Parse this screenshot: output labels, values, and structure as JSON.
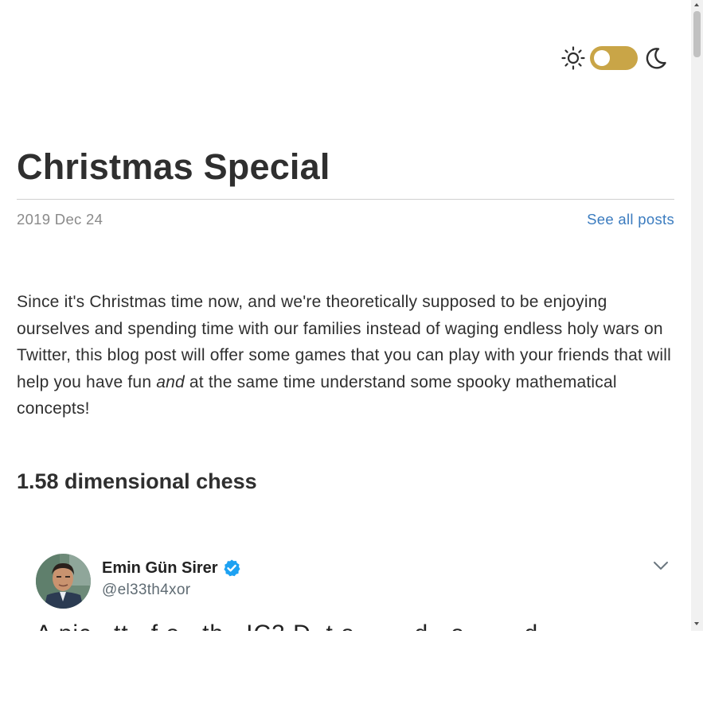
{
  "post": {
    "title": "Christmas Special",
    "date": "2019 Dec 24",
    "see_all_posts": "See all posts",
    "intro_before_em": "Since it's Christmas time now, and we're theoretically supposed to be enjoying ourselves and spending time with our families instead of waging endless holy wars on Twitter, this blog post will offer some games that you can play with your friends that will help you have fun ",
    "intro_em": "and",
    "intro_after_em": " at the same time understand some spooky mathematical concepts!",
    "section_heading": "1.58 dimensional chess"
  },
  "tweet": {
    "display_name": "Emin Gün Sirer",
    "handle": "@el33th4xor",
    "text_partial": "A pic ..tt.. f.o.. th.. IC3 D..t.o..... ..d ..o.....  ..d"
  },
  "theme_toggle": {
    "light_icon": "sun-icon",
    "dark_icon": "moon-icon",
    "accent_color": "#c9a547",
    "state": "light"
  },
  "colors": {
    "link": "#3a7bbf",
    "meta": "#8a8a8a",
    "text": "#2f2f2f",
    "verified": "#1da1f2"
  }
}
